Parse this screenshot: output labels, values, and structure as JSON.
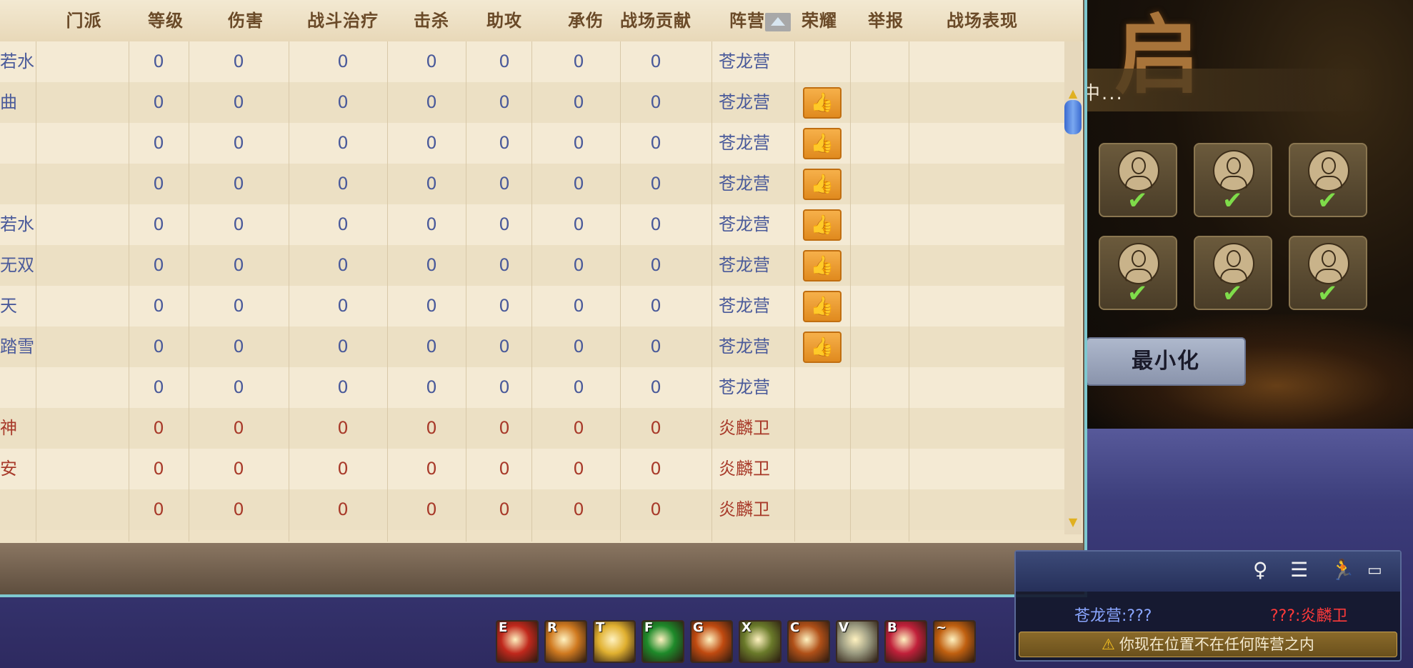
{
  "background": {
    "title_glyph": "启",
    "banner_text": "中...",
    "minimize_label": "最小化",
    "avatar_count": 6
  },
  "scoreboard": {
    "headers": [
      "门派",
      "等级",
      "伤害",
      "战斗治疗",
      "击杀",
      "助攻",
      "承伤",
      "战场贡献",
      "阵营",
      "荣耀",
      "举报",
      "战场表现"
    ],
    "rows": [
      {
        "name": "若水",
        "level": "0",
        "damage": "0",
        "heal": "0",
        "kills": "0",
        "assists": "0",
        "taken": "0",
        "contribution": "0",
        "camp": "苍龙营",
        "honor": false
      },
      {
        "name": "曲",
        "level": "0",
        "damage": "0",
        "heal": "0",
        "kills": "0",
        "assists": "0",
        "taken": "0",
        "contribution": "0",
        "camp": "苍龙营",
        "honor": true
      },
      {
        "name": "",
        "level": "0",
        "damage": "0",
        "heal": "0",
        "kills": "0",
        "assists": "0",
        "taken": "0",
        "contribution": "0",
        "camp": "苍龙营",
        "honor": true
      },
      {
        "name": "",
        "level": "0",
        "damage": "0",
        "heal": "0",
        "kills": "0",
        "assists": "0",
        "taken": "0",
        "contribution": "0",
        "camp": "苍龙营",
        "honor": true
      },
      {
        "name": "若水",
        "level": "0",
        "damage": "0",
        "heal": "0",
        "kills": "0",
        "assists": "0",
        "taken": "0",
        "contribution": "0",
        "camp": "苍龙营",
        "honor": true
      },
      {
        "name": "无双",
        "level": "0",
        "damage": "0",
        "heal": "0",
        "kills": "0",
        "assists": "0",
        "taken": "0",
        "contribution": "0",
        "camp": "苍龙营",
        "honor": true
      },
      {
        "name": "天",
        "level": "0",
        "damage": "0",
        "heal": "0",
        "kills": "0",
        "assists": "0",
        "taken": "0",
        "contribution": "0",
        "camp": "苍龙营",
        "honor": true
      },
      {
        "name": "踏雪",
        "level": "0",
        "damage": "0",
        "heal": "0",
        "kills": "0",
        "assists": "0",
        "taken": "0",
        "contribution": "0",
        "camp": "苍龙营",
        "honor": true
      },
      {
        "name": "",
        "level": "0",
        "damage": "0",
        "heal": "0",
        "kills": "0",
        "assists": "0",
        "taken": "0",
        "contribution": "0",
        "camp": "苍龙营",
        "honor": false
      },
      {
        "name": "神",
        "level": "0",
        "damage": "0",
        "heal": "0",
        "kills": "0",
        "assists": "0",
        "taken": "0",
        "contribution": "0",
        "camp": "炎麟卫",
        "honor": false
      },
      {
        "name": "安",
        "level": "0",
        "damage": "0",
        "heal": "0",
        "kills": "0",
        "assists": "0",
        "taken": "0",
        "contribution": "0",
        "camp": "炎麟卫",
        "honor": false
      },
      {
        "name": "",
        "level": "0",
        "damage": "0",
        "heal": "0",
        "kills": "0",
        "assists": "0",
        "taken": "0",
        "contribution": "0",
        "camp": "炎麟卫",
        "honor": false
      }
    ],
    "colors": {
      "blue_team": "#4a5a9a",
      "red_team": "#a83a2a"
    },
    "thumb_glyph": "👍"
  },
  "skills": [
    {
      "key": "E",
      "color": "#c0281c"
    },
    {
      "key": "R",
      "color": "#d07a20"
    },
    {
      "key": "T",
      "color": "#e0b030"
    },
    {
      "key": "F",
      "color": "#1e8a2a"
    },
    {
      "key": "G",
      "color": "#c04a10"
    },
    {
      "key": "X",
      "color": "#6a7a2a"
    },
    {
      "key": "C",
      "color": "#b05018"
    },
    {
      "key": "V",
      "color": "#9a9a80"
    },
    {
      "key": "B",
      "color": "#c0203a"
    },
    {
      "key": "~",
      "color": "#c06010"
    }
  ],
  "chat": {
    "icons": [
      "person-icon",
      "document-icon",
      "running-icon",
      "window-icon"
    ],
    "camp_left": "苍龙营:???",
    "camp_right": "???:炎麟卫",
    "warning": "你现在位置不在任何阵营之内"
  }
}
